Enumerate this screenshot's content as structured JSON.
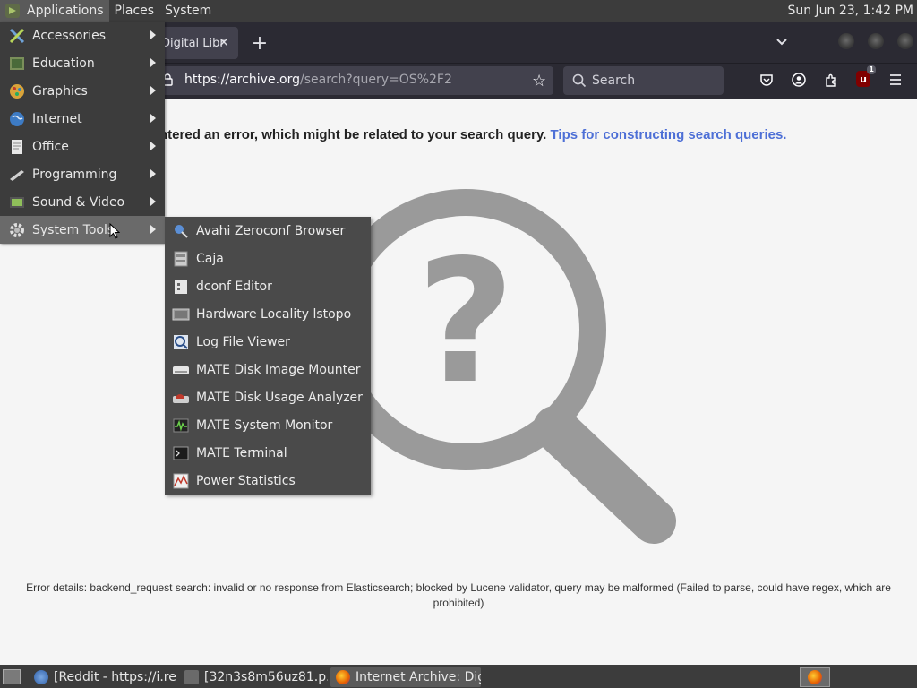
{
  "top_panel": {
    "menus": [
      "Applications",
      "Places",
      "System"
    ],
    "clock": "Sun Jun 23,  1:42 PM"
  },
  "browser": {
    "tab": {
      "title": "Digital Libr",
      "close": "✕"
    },
    "new_tab": "+",
    "url_host": "https://archive.org",
    "url_rest": "/search?query=OS%2F2",
    "search_placeholder": "Search",
    "ublock_count": "1"
  },
  "page": {
    "error_text": "ine encountered an error, which might be related to your search query. ",
    "error_link": "Tips for constructing search queries.",
    "error_details": "Error details: backend_request search: invalid or no response from Elasticsearch; blocked by Lucene validator, query may be malformed (Failed to parse, could have regex, which are prohibited)"
  },
  "app_menu": {
    "items": [
      {
        "label": "Accessories",
        "icon": "accessories-icon"
      },
      {
        "label": "Education",
        "icon": "education-icon"
      },
      {
        "label": "Graphics",
        "icon": "graphics-icon"
      },
      {
        "label": "Internet",
        "icon": "internet-icon"
      },
      {
        "label": "Office",
        "icon": "office-icon"
      },
      {
        "label": "Programming",
        "icon": "programming-icon"
      },
      {
        "label": "Sound & Video",
        "icon": "sound-video-icon"
      },
      {
        "label": "System Tools",
        "icon": "system-tools-icon"
      }
    ]
  },
  "system_tools_menu": {
    "items": [
      {
        "label": "Avahi Zeroconf Browser",
        "icon": "avahi-icon"
      },
      {
        "label": "Caja",
        "icon": "caja-icon"
      },
      {
        "label": "dconf Editor",
        "icon": "dconf-icon"
      },
      {
        "label": "Hardware Locality lstopo",
        "icon": "hardware-icon"
      },
      {
        "label": "Log File Viewer",
        "icon": "log-viewer-icon"
      },
      {
        "label": "MATE Disk Image Mounter",
        "icon": "disk-mounter-icon"
      },
      {
        "label": "MATE Disk Usage Analyzer",
        "icon": "disk-usage-icon"
      },
      {
        "label": "MATE System Monitor",
        "icon": "system-monitor-icon"
      },
      {
        "label": "MATE Terminal",
        "icon": "terminal-icon"
      },
      {
        "label": "Power Statistics",
        "icon": "power-stats-icon"
      }
    ]
  },
  "taskbar": {
    "tasks": [
      {
        "label": "[Reddit - https://i.re..."
      },
      {
        "label": "[32n3s8m56uz81.p..."
      },
      {
        "label": "Internet Archive: Dig..."
      }
    ]
  },
  "colors": {
    "panel_bg": "#3c3c3c",
    "browser_bg": "#2b2a33",
    "link": "#4d6fd6",
    "magnifier": "#9a9a9a"
  }
}
